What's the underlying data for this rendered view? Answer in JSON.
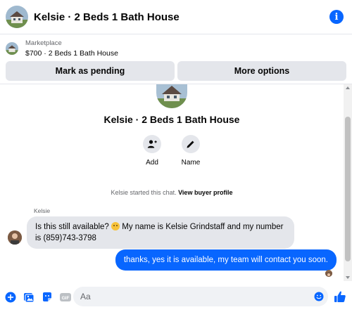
{
  "header": {
    "title": "Kelsie · 2 Beds 1 Bath House"
  },
  "listing": {
    "label": "Marketplace",
    "item": "$700 · 2 Beds 1 Bath House",
    "buttons": {
      "pending": "Mark as pending",
      "more": "More options"
    }
  },
  "profile": {
    "name": "Kelsie · 2 Beds 1 Bath House",
    "actions": [
      {
        "label": "Add",
        "icon": "add-person-icon"
      },
      {
        "label": "Name",
        "icon": "pencil-icon"
      }
    ]
  },
  "chat": {
    "started_text": "Kelsie started this chat.",
    "view_profile": "View buyer profile",
    "sender": "Kelsie",
    "incoming": {
      "before_emoji": "Is this still available?",
      "after_emoji": "My name is Kelsie Grindstaff and my number is (859)743-3798"
    },
    "outgoing": "thanks, yes it is available, my team will contact you soon."
  },
  "composer": {
    "placeholder": "Aa",
    "value": ""
  },
  "colors": {
    "accent": "#0866ff",
    "bubble_in": "#e4e6eb",
    "muted": "#65676b"
  }
}
